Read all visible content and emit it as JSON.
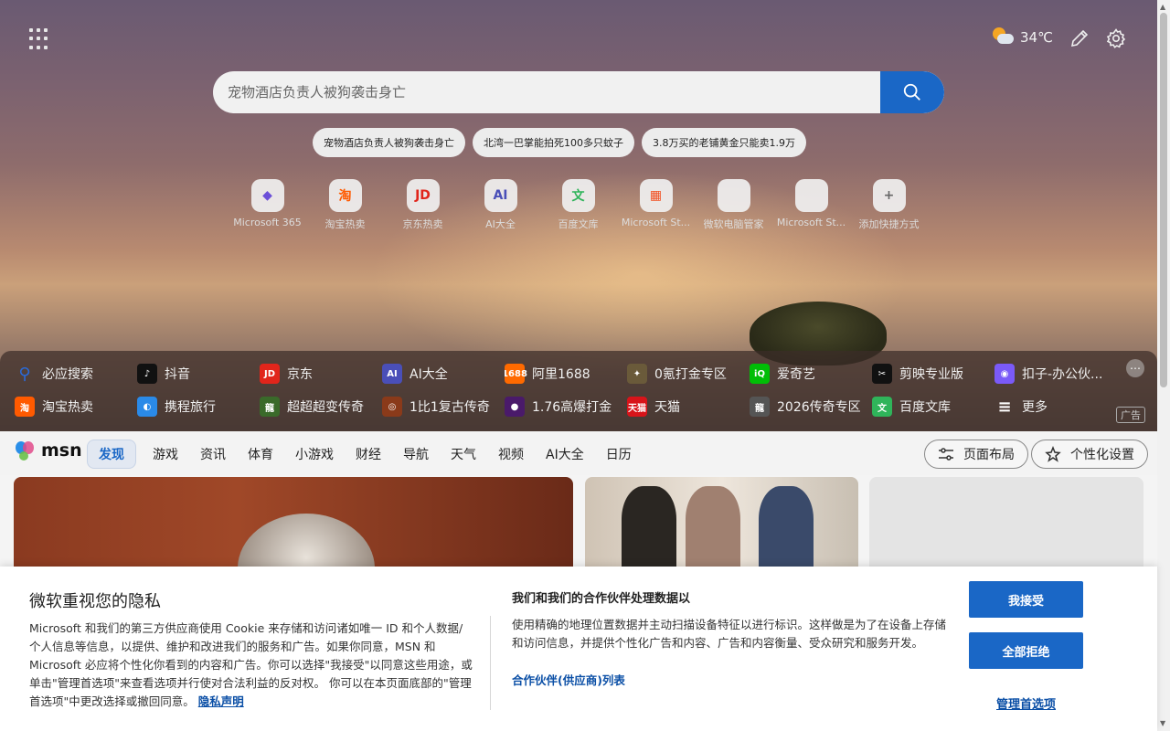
{
  "weather": {
    "temp": "34℃"
  },
  "search": {
    "placeholder": "宠物酒店负责人被狗袭击身亡"
  },
  "trending": [
    "宠物酒店负责人被狗袭击身亡",
    "北湾一巴掌能拍死100多只蚊子",
    "3.8万买的老铺黄金只能卖1.9万"
  ],
  "quick_links": [
    {
      "label": "Microsoft 365",
      "icon": "microsoft-365-icon",
      "glyph": "◆",
      "color": "#6b4fd8"
    },
    {
      "label": "淘宝热卖",
      "icon": "taobao-icon",
      "glyph": "淘",
      "color": "#ff5a00"
    },
    {
      "label": "京东热卖",
      "icon": "jd-icon",
      "glyph": "JD",
      "color": "#e1251b"
    },
    {
      "label": "AI大全",
      "icon": "ai-icon",
      "glyph": "AI",
      "color": "#4a4fb8"
    },
    {
      "label": "百度文库",
      "icon": "baidu-wenku-icon",
      "glyph": "文",
      "color": "#2fb45a"
    },
    {
      "label": "Microsoft St...",
      "icon": "microsoft-store-icon",
      "glyph": "▦",
      "color": "#f25022"
    },
    {
      "label": "微软电脑管家",
      "icon": "pc-manager-icon",
      "glyph": "",
      "color": "#999999"
    },
    {
      "label": "Microsoft St...",
      "icon": "microsoft-store-icon",
      "glyph": "",
      "color": "#999999"
    },
    {
      "label": "添加快捷方式",
      "icon": "add-icon",
      "glyph": "+",
      "color": "#666666"
    }
  ],
  "shortcuts_row1": [
    {
      "label": "必应搜索",
      "icon": "bing-search-icon",
      "glyph": "⚲",
      "color": "#2a6ad8"
    },
    {
      "label": "抖音",
      "icon": "douyin-icon",
      "glyph": "♪",
      "color": "#111111"
    },
    {
      "label": "京东",
      "icon": "jd-icon",
      "glyph": "JD",
      "color": "#e1251b"
    },
    {
      "label": "AI大全",
      "icon": "ai-icon",
      "glyph": "AI",
      "color": "#4a4fb8"
    },
    {
      "label": "阿里1688",
      "icon": "alibaba-1688-icon",
      "glyph": "1688",
      "color": "#ff6a00"
    },
    {
      "label": "0氪打金专区",
      "icon": "game-icon",
      "glyph": "✦",
      "color": "#6a5a3a"
    },
    {
      "label": "爱奇艺",
      "icon": "iqiyi-icon",
      "glyph": "iQ",
      "color": "#00be06"
    },
    {
      "label": "剪映专业版",
      "icon": "jianying-icon",
      "glyph": "✂",
      "color": "#111111"
    },
    {
      "label": "扣子-办公伙...",
      "icon": "coze-icon",
      "glyph": "◉",
      "color": "#7a5af8"
    }
  ],
  "shortcuts_row2": [
    {
      "label": "淘宝热卖",
      "icon": "taobao-icon",
      "glyph": "淘",
      "color": "#ff5a00"
    },
    {
      "label": "携程旅行",
      "icon": "ctrip-icon",
      "glyph": "◐",
      "color": "#2a8ae8"
    },
    {
      "label": "超超超变传奇",
      "icon": "legend-game-icon",
      "glyph": "龍",
      "color": "#3a6a2a"
    },
    {
      "label": "1比1复古传奇",
      "icon": "legend-game-icon",
      "glyph": "◎",
      "color": "#8a3a1a"
    },
    {
      "label": "1.76高爆打金",
      "icon": "legend-game-icon",
      "glyph": "●",
      "color": "#4a1a6a"
    },
    {
      "label": "天猫",
      "icon": "tmall-icon",
      "glyph": "天猫",
      "color": "#d8141a"
    },
    {
      "label": "2026传奇专区",
      "icon": "legend-game-icon",
      "glyph": "龍",
      "color": "#555555"
    },
    {
      "label": "百度文库",
      "icon": "baidu-wenku-icon",
      "glyph": "文",
      "color": "#2fb45a"
    },
    {
      "label": "更多",
      "icon": "more-menu-icon",
      "glyph": "≡",
      "color": "transparent"
    }
  ],
  "ad_label": "广告",
  "msn": {
    "logo": "msn",
    "tabs": [
      "发现",
      "游戏",
      "资讯",
      "体育",
      "小游戏",
      "财经",
      "导航",
      "天气",
      "视频",
      "AI大全",
      "日历"
    ],
    "layout_button": "页面布局",
    "personalize_button": "个性化设置"
  },
  "consent": {
    "title": "微软重视您的隐私",
    "body": "Microsoft 和我们的第三方供应商使用 Cookie 来存储和访问诸如唯一 ID 和个人数据/个人信息等信息，以提供、维护和改进我们的服务和广告。如果你同意，MSN 和 Microsoft 必应将个性化你看到的内容和广告。你可以选择\"我接受\"以同意这些用途，或单击\"管理首选项\"来查看选项并行使对合法利益的反对权。 你可以在本页面底部的\"管理首选项\"中更改选择或撤回同意。",
    "privacy_link": "隐私声明",
    "purpose_title": "我们和我们的合作伙伴处理数据以",
    "purpose_body": "使用精确的地理位置数据并主动扫描设备特征以进行标识。这样做是为了在设备上存储和访问信息，并提供个性化广告和内容、广告和内容衡量、受众研究和服务开发。",
    "partners_link": "合作伙伴(供应商)列表",
    "accept_button": "我接受",
    "reject_button": "全部拒绝",
    "manage_link": "管理首选项"
  }
}
